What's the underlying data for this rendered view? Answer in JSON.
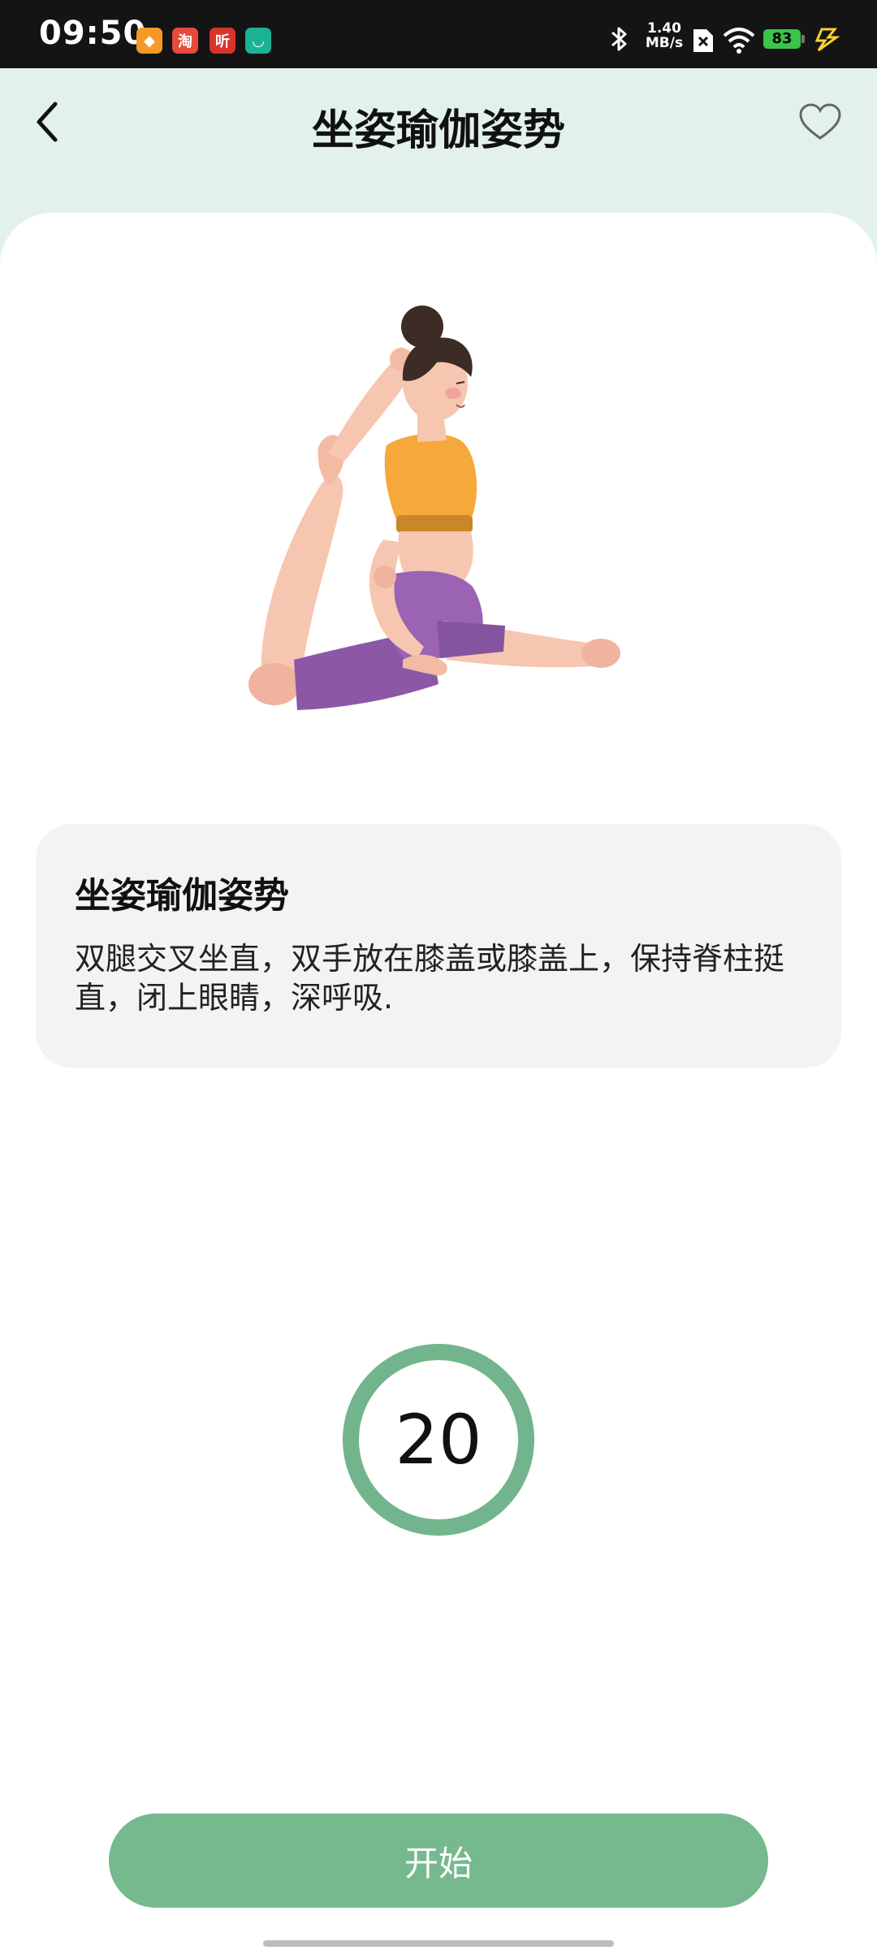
{
  "status_bar": {
    "time": "09:50",
    "net_speed_top": "1.40",
    "net_speed_bottom": "MB/s",
    "battery": "83",
    "app_icons": [
      "taobao-flash-icon",
      "taobao-icon",
      "listen-icon",
      "mijia-icon"
    ]
  },
  "header": {
    "title": "坐姿瑜伽姿势",
    "back_icon": "chevron-left-icon",
    "favorite_icon": "heart-outline-icon"
  },
  "pose": {
    "title": "坐姿瑜伽姿势",
    "description": "双腿交叉坐直，双手放在膝盖或膝盖上，保持脊柱挺直，闭上眼睛，深呼吸."
  },
  "timer": {
    "value": "20"
  },
  "start_button": {
    "label": "开始"
  },
  "colors": {
    "header_bg": "#e2f2ea",
    "accent_green": "#76b98e",
    "ring_green": "#72b58d",
    "info_card_bg": "#f3f3f3"
  }
}
